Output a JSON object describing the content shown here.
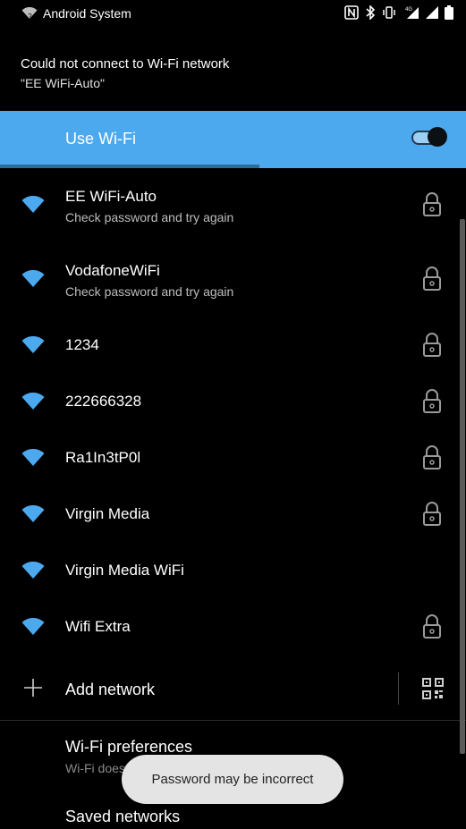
{
  "status_bar": {
    "app_label": "Android System",
    "icons": [
      "wifi-unknown-icon",
      "nfc-icon",
      "bluetooth-icon",
      "vibrate-icon",
      "signal-4g-icon",
      "signal-icon",
      "battery-icon"
    ],
    "network_type": "4G"
  },
  "notification": {
    "title": "Could not connect to Wi-Fi network",
    "subtitle": "\"EE WiFi-Auto\""
  },
  "wifi_header": {
    "label": "Use Wi-Fi",
    "toggle_on": true,
    "accent_color": "#4da9ee"
  },
  "networks": [
    {
      "name": "EE WiFi-Auto",
      "status": "Check password and try again",
      "secured": true
    },
    {
      "name": "VodafoneWiFi",
      "status": "Check password and try again",
      "secured": true
    },
    {
      "name": "1234",
      "status": "",
      "secured": true
    },
    {
      "name": "222666328",
      "status": "",
      "secured": true
    },
    {
      "name": "Ra1In3tP0l",
      "status": "",
      "secured": true
    },
    {
      "name": "Virgin Media",
      "status": "",
      "secured": true
    },
    {
      "name": "Virgin Media WiFi",
      "status": "",
      "secured": false
    },
    {
      "name": "Wifi Extra",
      "status": "",
      "secured": true
    }
  ],
  "add_network": {
    "label": "Add network"
  },
  "preferences": {
    "title": "Wi-Fi preferences",
    "subtitle": "Wi-Fi doesn't turn back on automatically"
  },
  "saved_networks": {
    "label": "Saved networks"
  },
  "toast": {
    "message": "Password may be incorrect"
  }
}
